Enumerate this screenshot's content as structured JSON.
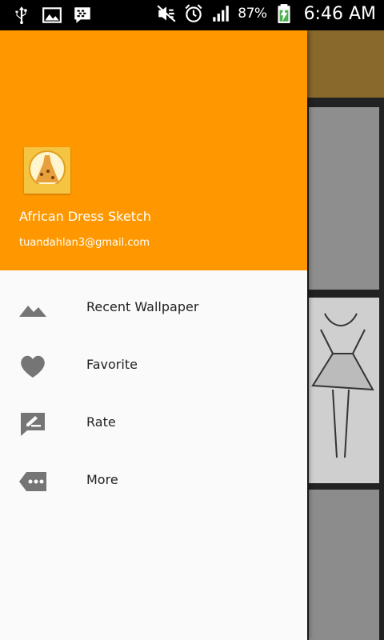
{
  "status_bar": {
    "battery_percent": "87%",
    "time": "6:46 AM",
    "icons": [
      "usb-icon",
      "image-icon",
      "bbm-icon",
      "mute-icon",
      "alarm-icon",
      "signal-icon",
      "battery-charging-icon"
    ]
  },
  "drawer": {
    "header_color": "#ff9800",
    "app_name": "African Dress Sketch",
    "email": "tuandahlan3@gmail.com",
    "logo_icon": "dress-logo-icon",
    "items": [
      {
        "label": "Recent Wallpaper",
        "icon": "mountains-icon"
      },
      {
        "label": "Favorite",
        "icon": "heart-icon"
      },
      {
        "label": "Rate",
        "icon": "rate-edit-icon"
      },
      {
        "label": "More",
        "icon": "more-tag-icon"
      }
    ]
  }
}
